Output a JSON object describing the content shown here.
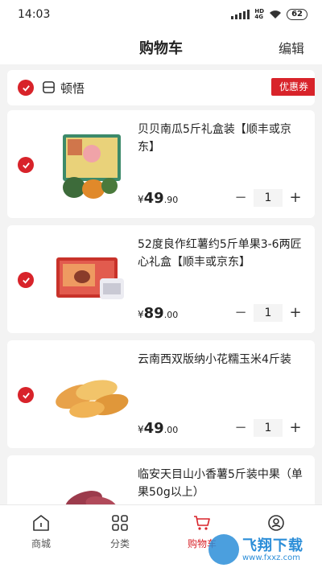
{
  "status_bar": {
    "time": "14:03",
    "network": "4G",
    "battery": "62"
  },
  "header": {
    "title": "购物车",
    "edit_label": "编辑"
  },
  "shop": {
    "name": "顿悟",
    "coupon_label": "优惠券"
  },
  "cart_items": [
    {
      "title": "贝贝南瓜5斤礼盒装【顺丰或京东】",
      "currency": "¥",
      "price_int": "49",
      "price_dec": ".90",
      "quantity": "1",
      "minus": "−",
      "plus": "+"
    },
    {
      "title": "52度良作红薯约5斤单果3-6两匠心礼盒【顺丰或京东】",
      "currency": "¥",
      "price_int": "89",
      "price_dec": ".00",
      "quantity": "1",
      "minus": "−",
      "plus": "+"
    },
    {
      "title": "云南西双版纳小花糯玉米4斤装",
      "currency": "¥",
      "price_int": "49",
      "price_dec": ".00",
      "quantity": "1",
      "minus": "−",
      "plus": "+"
    },
    {
      "title": "临安天目山小香薯5斤装中果（单果50g以上）",
      "currency": "¥",
      "price_int": "",
      "price_dec": "",
      "quantity": "",
      "minus": "",
      "plus": ""
    }
  ],
  "tabs": [
    {
      "label": "商城",
      "icon": "home-icon"
    },
    {
      "label": "分类",
      "icon": "category-icon"
    },
    {
      "label": "购物车",
      "icon": "cart-icon",
      "active": true
    },
    {
      "label": "",
      "icon": "user-icon"
    }
  ],
  "watermark": {
    "text": "飞翔下载",
    "url": "www.fxxz.com"
  },
  "colors": {
    "accent": "#d8232a",
    "background": "#f3f3f3",
    "card": "#ffffff",
    "watermark": "#2c8ed8"
  }
}
